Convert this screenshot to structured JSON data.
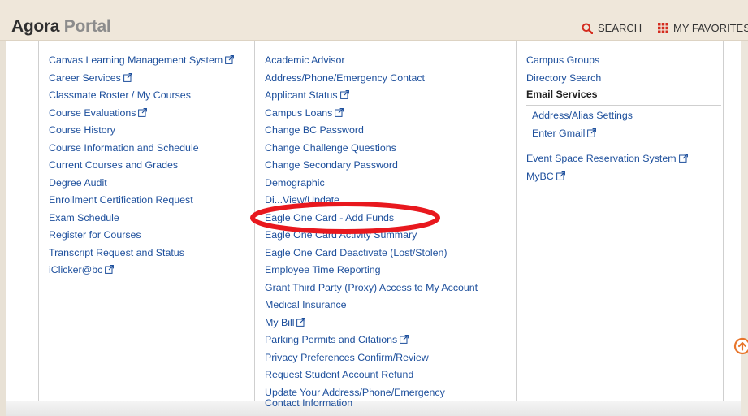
{
  "header": {
    "brand_main": "Agora",
    "brand_sub": "Portal",
    "search_label": "SEARCH",
    "favorites_label": "MY FAVORITES",
    "accent_color": "#d42b1e"
  },
  "column1": [
    {
      "label": "Canvas Learning Management System",
      "external": true
    },
    {
      "label": "Career Services",
      "external": true
    },
    {
      "label": "Classmate Roster / My Courses",
      "external": false
    },
    {
      "label": "Course Evaluations",
      "external": true
    },
    {
      "label": "Course History",
      "external": false
    },
    {
      "label": "Course Information and Schedule",
      "external": false
    },
    {
      "label": "Current Courses and Grades",
      "external": false
    },
    {
      "label": "Degree Audit",
      "external": false
    },
    {
      "label": "Enrollment Certification Request",
      "external": false
    },
    {
      "label": "Exam Schedule",
      "external": false
    },
    {
      "label": "Register for Courses",
      "external": false
    },
    {
      "label": "Transcript Request and Status",
      "external": false
    },
    {
      "label": "iClicker@bc",
      "external": true
    }
  ],
  "column2": [
    {
      "label": "Academic Advisor",
      "external": false
    },
    {
      "label": "Address/Phone/Emergency Contact",
      "external": false
    },
    {
      "label": "Applicant Status",
      "external": true
    },
    {
      "label": "Campus Loans",
      "external": true
    },
    {
      "label": "Change BC Password",
      "external": false
    },
    {
      "label": "Change Challenge Questions",
      "external": false
    },
    {
      "label": "Change Secondary Password",
      "external": false
    },
    {
      "label": "Demographic",
      "external": false
    },
    {
      "label": "Di...View/Update",
      "external": false
    },
    {
      "label": "Eagle One Card - Add Funds",
      "external": false
    },
    {
      "label": "Eagle One Card Activity Summary",
      "external": false
    },
    {
      "label": "Eagle One Card Deactivate (Lost/Stolen)",
      "external": false
    },
    {
      "label": "Employee Time Reporting",
      "external": false
    },
    {
      "label": "Grant Third Party (Proxy) Access to My Account",
      "external": false
    },
    {
      "label": "Medical Insurance",
      "external": false
    },
    {
      "label": "My Bill",
      "external": true
    },
    {
      "label": "Parking Permits and Citations",
      "external": true
    },
    {
      "label": "Privacy Preferences Confirm/Review",
      "external": false
    },
    {
      "label": "Request Student Account Refund",
      "external": false
    },
    {
      "label": "Update Your Address/Phone/Emergency Contact Information",
      "external": false,
      "two_line": true
    }
  ],
  "column3": {
    "items_top": [
      {
        "label": "Campus Groups",
        "external": false
      },
      {
        "label": "Directory Search",
        "external": false
      }
    ],
    "email_title": "Email Services",
    "email_items": [
      {
        "label": "Address/Alias Settings",
        "external": false
      },
      {
        "label": "Enter Gmail",
        "external": true
      }
    ],
    "items_bottom": [
      {
        "label": "Event Space Reservation System",
        "external": true
      },
      {
        "label": "MyBC",
        "external": true
      }
    ]
  },
  "annotation": {
    "target": "Eagle One Card - Add Funds",
    "color": "#e8181e"
  }
}
